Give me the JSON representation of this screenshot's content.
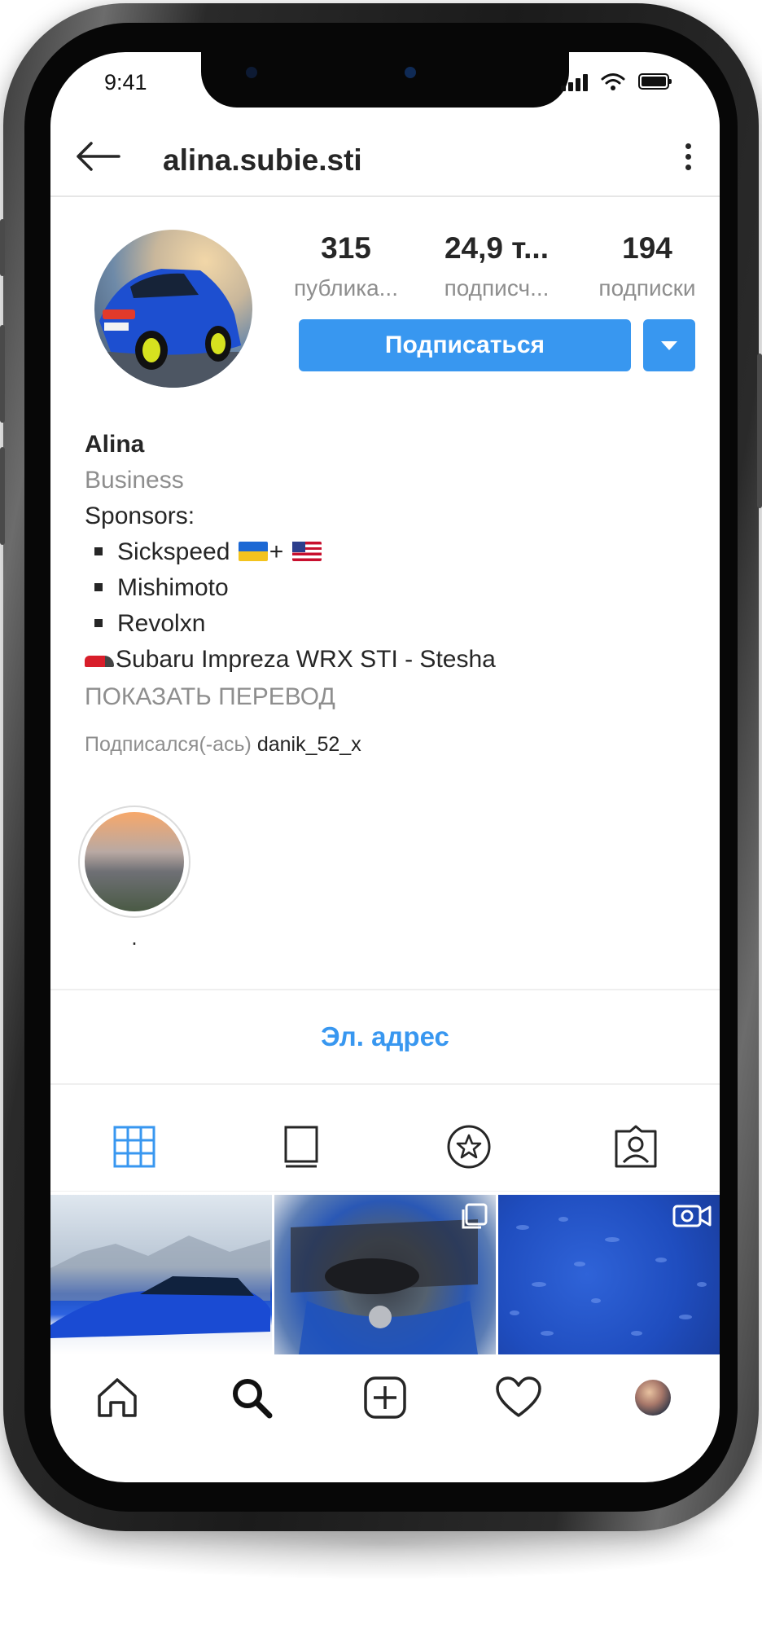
{
  "status_bar": {
    "time": "9:41"
  },
  "header": {
    "username": "alina.subie.sti"
  },
  "profile": {
    "stats": [
      {
        "value": "315",
        "label": "публика..."
      },
      {
        "value": "24,9 т...",
        "label": "подписч..."
      },
      {
        "value": "194",
        "label": "подписки"
      }
    ],
    "follow_label": "Подписаться"
  },
  "bio": {
    "name": "Alina",
    "category": "Business",
    "sponsors_heading": "Sponsors:",
    "sponsors": [
      "Sickspeed",
      "Mishimoto",
      "Revolxn"
    ],
    "sponsor_plus": "+",
    "car": "Subaru Impreza WRX STI - Stesha",
    "translate": "ПОКАЗАТЬ ПЕРЕВОД",
    "followed_by_prefix": "Подписался(-ась)",
    "followed_by_user": "danik_52_x"
  },
  "highlights": [
    {
      "label": "."
    }
  ],
  "contact": {
    "label": "Эл. адрес"
  },
  "tabs": [
    "grid-icon",
    "tv-icon",
    "star-icon",
    "tagged-user-icon"
  ],
  "colors": {
    "accent": "#3897f0",
    "text": "#262626",
    "muted": "#8e8e8e"
  }
}
